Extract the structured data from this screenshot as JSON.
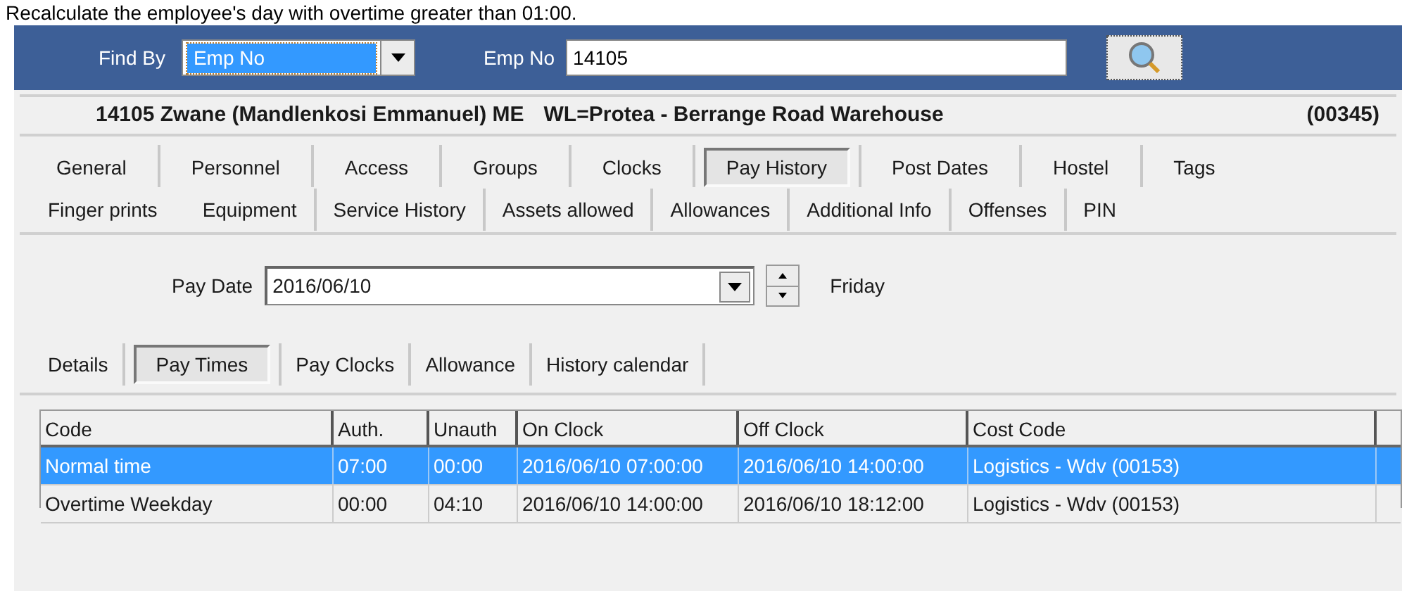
{
  "caption": "Recalculate the employee's day with overtime greater than 01:00.",
  "find_bar": {
    "find_by_label": "Find By",
    "find_by_value": "Emp No",
    "emp_no_label": "Emp No",
    "emp_no_value": "14105"
  },
  "employee_header": {
    "name": "14105 Zwane (Mandlenkosi Emmanuel) ME",
    "work_location": "WL=Protea - Berrange Road Warehouse",
    "code": "(00345)"
  },
  "tabs_row_1": [
    {
      "label": "General",
      "selected": false
    },
    {
      "label": "Personnel",
      "selected": false
    },
    {
      "label": "Access",
      "selected": false
    },
    {
      "label": "Groups",
      "selected": false
    },
    {
      "label": "Clocks",
      "selected": false
    },
    {
      "label": "Pay History",
      "selected": true
    },
    {
      "label": "Post Dates",
      "selected": false
    },
    {
      "label": "Hostel",
      "selected": false
    },
    {
      "label": "Tags",
      "selected": false
    }
  ],
  "tabs_row_2": [
    {
      "label": "Finger prints",
      "selected": false
    },
    {
      "label": "Equipment",
      "selected": false
    },
    {
      "label": "Service History",
      "selected": false
    },
    {
      "label": "Assets allowed",
      "selected": false
    },
    {
      "label": "Allowances",
      "selected": false
    },
    {
      "label": "Additional Info",
      "selected": false
    },
    {
      "label": "Offenses",
      "selected": false
    },
    {
      "label": "PIN",
      "selected": false
    }
  ],
  "pay_date": {
    "label": "Pay Date",
    "value": "2016/06/10",
    "weekday": "Friday"
  },
  "sub_tabs": [
    {
      "label": "Details",
      "selected": false
    },
    {
      "label": "Pay Times",
      "selected": true
    },
    {
      "label": "Pay Clocks",
      "selected": false
    },
    {
      "label": "Allowance",
      "selected": false
    },
    {
      "label": "History calendar",
      "selected": false
    }
  ],
  "table": {
    "columns": [
      "Code",
      "Auth.",
      "Unauth",
      "On Clock",
      "Off Clock",
      "Cost Code"
    ],
    "rows": [
      {
        "selected": true,
        "cells": [
          "Normal time",
          "07:00",
          "00:00",
          "2016/06/10 07:00:00",
          "2016/06/10 14:00:00",
          "Logistics - Wdv (00153)"
        ]
      },
      {
        "selected": false,
        "cells": [
          "Overtime Weekday",
          "00:00",
          "04:10",
          "2016/06/10 14:00:00",
          "2016/06/10 18:12:00",
          "Logistics - Wdv (00153)"
        ]
      }
    ]
  }
}
